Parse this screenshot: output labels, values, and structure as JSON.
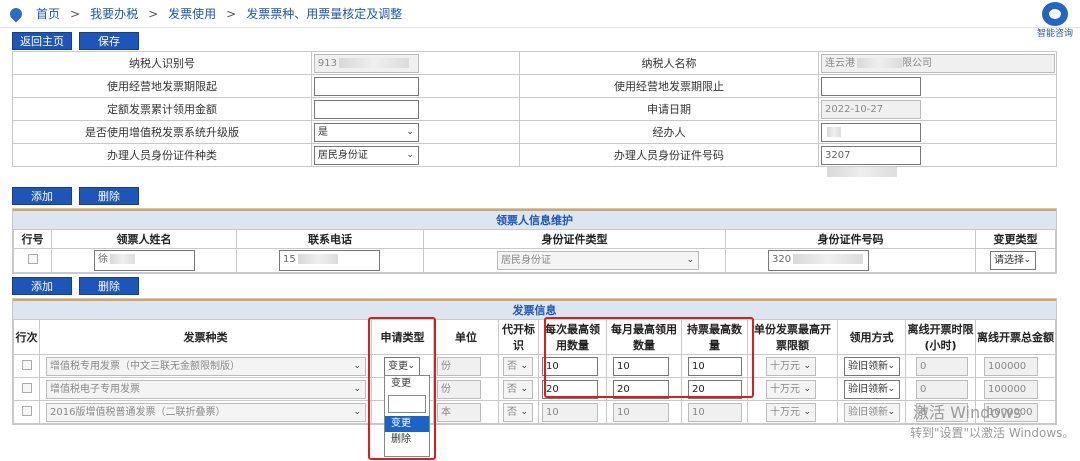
{
  "breadcrumb": [
    "首页",
    "我要办税",
    "发票使用",
    "发票票种、用票量核定及调整"
  ],
  "assistant_label": "智能咨询",
  "top_buttons": {
    "back": "返回主页",
    "save": "保存"
  },
  "taxpayer_form": {
    "rows": [
      {
        "l1": "纳税人识别号",
        "v1": "913",
        "l2": "纳税人名称",
        "v2": "连云港",
        "v2b": "限公司"
      },
      {
        "l1": "使用经营地发票期限起",
        "v1": "",
        "l2": "使用经营地发票期限止",
        "v2": ""
      },
      {
        "l1": "定额发票累计领用金额",
        "v1": "",
        "l2": "申请日期",
        "v2": "2022-10-27"
      },
      {
        "l1": "是否使用增值税发票系统升级版",
        "v1": "是",
        "l2": "经办人",
        "v2": ""
      },
      {
        "l1": "办理人员身份证件种类",
        "v1": "居民身份证",
        "l2": "办理人员身份证件号码",
        "v2": "3207"
      }
    ]
  },
  "recipient_buttons": {
    "add": "添加",
    "delete": "删除"
  },
  "recipient_section": {
    "title": "领票人信息维护",
    "headers": [
      "行号",
      "领票人姓名",
      "联系电话",
      "身份证件类型",
      "身份证件号码",
      "变更类型"
    ],
    "row": {
      "name": "徐",
      "phone": "15",
      "id_type": "居民身份证",
      "id_no": "320",
      "change": "请选择"
    }
  },
  "invoice_buttons": {
    "add": "添加",
    "delete": "删除"
  },
  "invoice_section": {
    "title": "发票信息",
    "headers": [
      "行次",
      "发票种类",
      "申请类型",
      "单位",
      "代开标识",
      "每次最高领用数量",
      "每月最高领用数量",
      "持票最高数量",
      "单份发票最高开票限额",
      "领用方式",
      "离线开票时限(小时)",
      "离线开票总金额"
    ],
    "rows": [
      {
        "type": "增值税专用发票（中文三联无金额限制版）",
        "apply": "变更",
        "unit": "份",
        "agent": "否",
        "per_time": "10",
        "per_month": "10",
        "hold": "10",
        "limit": "十万元",
        "method": "验旧领新",
        "offline_hours": "0",
        "offline_amount": "100000"
      },
      {
        "type": "增值税电子专用发票",
        "apply": "变更",
        "unit": "份",
        "agent": "否",
        "per_time": "20",
        "per_month": "20",
        "hold": "20",
        "limit": "十万元",
        "method": "验旧领新",
        "offline_hours": "0",
        "offline_amount": "100000"
      },
      {
        "type": "2016版增值税普通发票（二联折叠票）",
        "apply": "",
        "unit": "本",
        "agent": "否",
        "per_time": "10",
        "per_month": "10",
        "hold": "10",
        "limit": "十万元",
        "method": "验旧领新",
        "offline_hours": "0",
        "offline_amount": "1000000"
      }
    ]
  },
  "dropdown": {
    "options": [
      "变更",
      "变更",
      "删除"
    ],
    "selected_index": 1
  },
  "watermark": {
    "line1": "激活 Windows",
    "line2": "转到\"设置\"以激活 Windows。"
  },
  "colors": {
    "accent": "#1d56b8",
    "highlight": "#e01b1b"
  }
}
